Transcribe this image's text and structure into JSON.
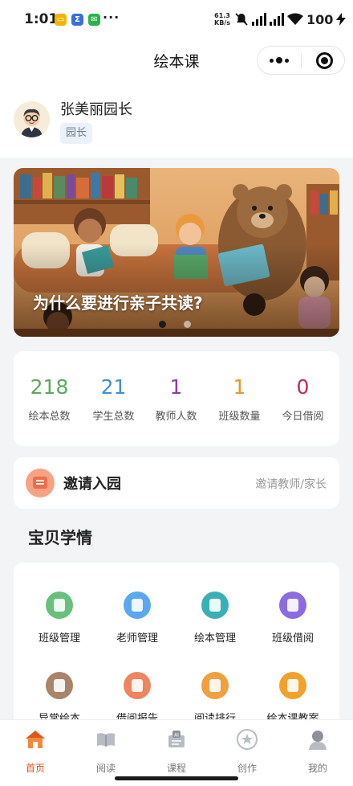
{
  "status_bar": {
    "time": "1:01",
    "speed_value": "61.3",
    "speed_unit": "KB/s",
    "battery": "100",
    "more": "···"
  },
  "nav": {
    "title": "绘本课"
  },
  "profile": {
    "name": "张美丽园长",
    "role": "园长"
  },
  "banner": {
    "caption": "为什么要进行亲子共读?",
    "slides": 2,
    "active_slide": 1
  },
  "stats": [
    {
      "value": "218",
      "label": "绘本总数",
      "color": "#5aa85c"
    },
    {
      "value": "21",
      "label": "学生总数",
      "color": "#3f8fd6"
    },
    {
      "value": "1",
      "label": "教师人数",
      "color": "#8e3aa8"
    },
    {
      "value": "1",
      "label": "班级数量",
      "color": "#e8962a"
    },
    {
      "value": "0",
      "label": "今日借阅",
      "color": "#c2275a"
    }
  ],
  "invite": {
    "title": "邀请入园",
    "subtitle": "邀请教师/家长"
  },
  "section": {
    "title": "宝贝学情"
  },
  "grid": [
    {
      "label": "班级管理",
      "icon": "class-management-icon",
      "color": "#67c07b"
    },
    {
      "label": "老师管理",
      "icon": "teacher-management-icon",
      "color": "#5aa8ef"
    },
    {
      "label": "绘本管理",
      "icon": "book-management-icon",
      "color": "#3ab0b6"
    },
    {
      "label": "班级借阅",
      "icon": "class-borrow-icon",
      "color": "#8c6be0"
    },
    {
      "label": "异常绘本",
      "icon": "abnormal-book-icon",
      "color": "#a8856a"
    },
    {
      "label": "借阅报告",
      "icon": "borrow-report-icon",
      "color": "#ef8560"
    },
    {
      "label": "阅读排行",
      "icon": "reading-rank-icon",
      "color": "#f0a040"
    },
    {
      "label": "绘本课教案",
      "icon": "lesson-plan-icon",
      "color": "#f2a22c"
    }
  ],
  "tabs": [
    {
      "label": "首页",
      "icon": "home-icon",
      "active": true
    },
    {
      "label": "阅读",
      "icon": "book-icon",
      "active": false
    },
    {
      "label": "课程",
      "icon": "ai-course-icon",
      "active": false
    },
    {
      "label": "创作",
      "icon": "star-icon",
      "active": false
    },
    {
      "label": "我的",
      "icon": "profile-icon",
      "active": false
    }
  ]
}
